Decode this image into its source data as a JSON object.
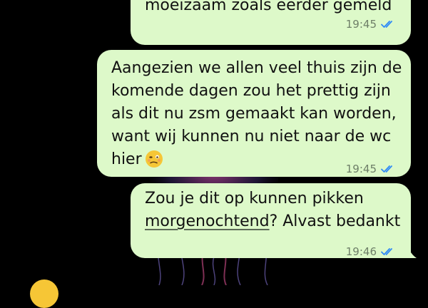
{
  "chat": {
    "messages": [
      {
        "lines": [
          "moeizaam zoals eerder gemeld"
        ],
        "time": "19:45",
        "status": "read-double-check-icon"
      },
      {
        "lines": [
          "Aangezien we allen veel thuis zijn de",
          "komende dagen zou het prettig zijn",
          "als dit nu zsm gemaakt kan worden,",
          "want wij kunnen nu niet naar de wc",
          "hier"
        ],
        "emoji": "woozy-face-emoji",
        "time": "19:45",
        "status": "read-double-check-icon"
      },
      {
        "lines": [
          "Zou je dit op kunnen pikken",
          "morgenochtend",
          "? Alvast bedankt"
        ],
        "time": "19:46",
        "status": "read-double-check-icon"
      }
    ]
  },
  "colors": {
    "outgoing_bubble": "#DDF9C9",
    "read_ticks": "#2F8AF6",
    "background": "#000000"
  }
}
